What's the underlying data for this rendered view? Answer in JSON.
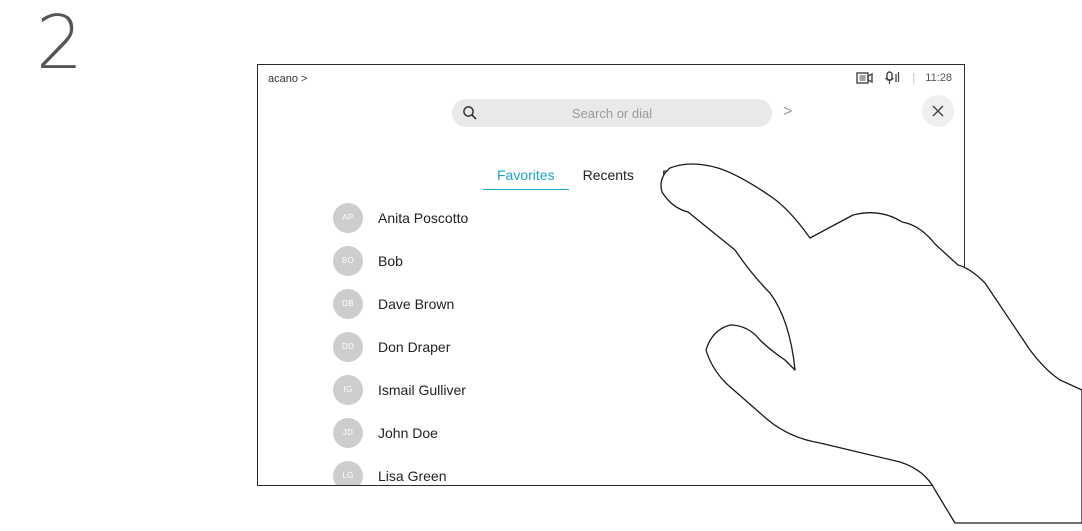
{
  "step": "2",
  "device": {
    "breadcrumb": "acano >",
    "status": {
      "camera_icon": "camera-icon",
      "mic_icon": "microphone-icon",
      "separator": "|",
      "time": "11:28"
    },
    "search": {
      "placeholder": "Search or dial",
      "search_icon": "search-icon",
      "arrow": ">"
    },
    "close_label": "×",
    "tabs": [
      {
        "label": "Favorites",
        "active": true
      },
      {
        "label": "Recents",
        "active": false
      },
      {
        "label": "Directory",
        "active": false
      }
    ],
    "contacts": [
      {
        "initials": "AP",
        "name": "Anita Poscotto"
      },
      {
        "initials": "BO",
        "name": "Bob"
      },
      {
        "initials": "DB",
        "name": "Dave Brown"
      },
      {
        "initials": "DD",
        "name": "Don Draper"
      },
      {
        "initials": "IG",
        "name": "Ismail Gulliver"
      },
      {
        "initials": "JD",
        "name": "John Doe"
      },
      {
        "initials": "LG",
        "name": "Lisa Green"
      }
    ],
    "accent_color": "#19a5c9"
  },
  "overlay": {
    "icon": "pointing-hand-icon"
  }
}
